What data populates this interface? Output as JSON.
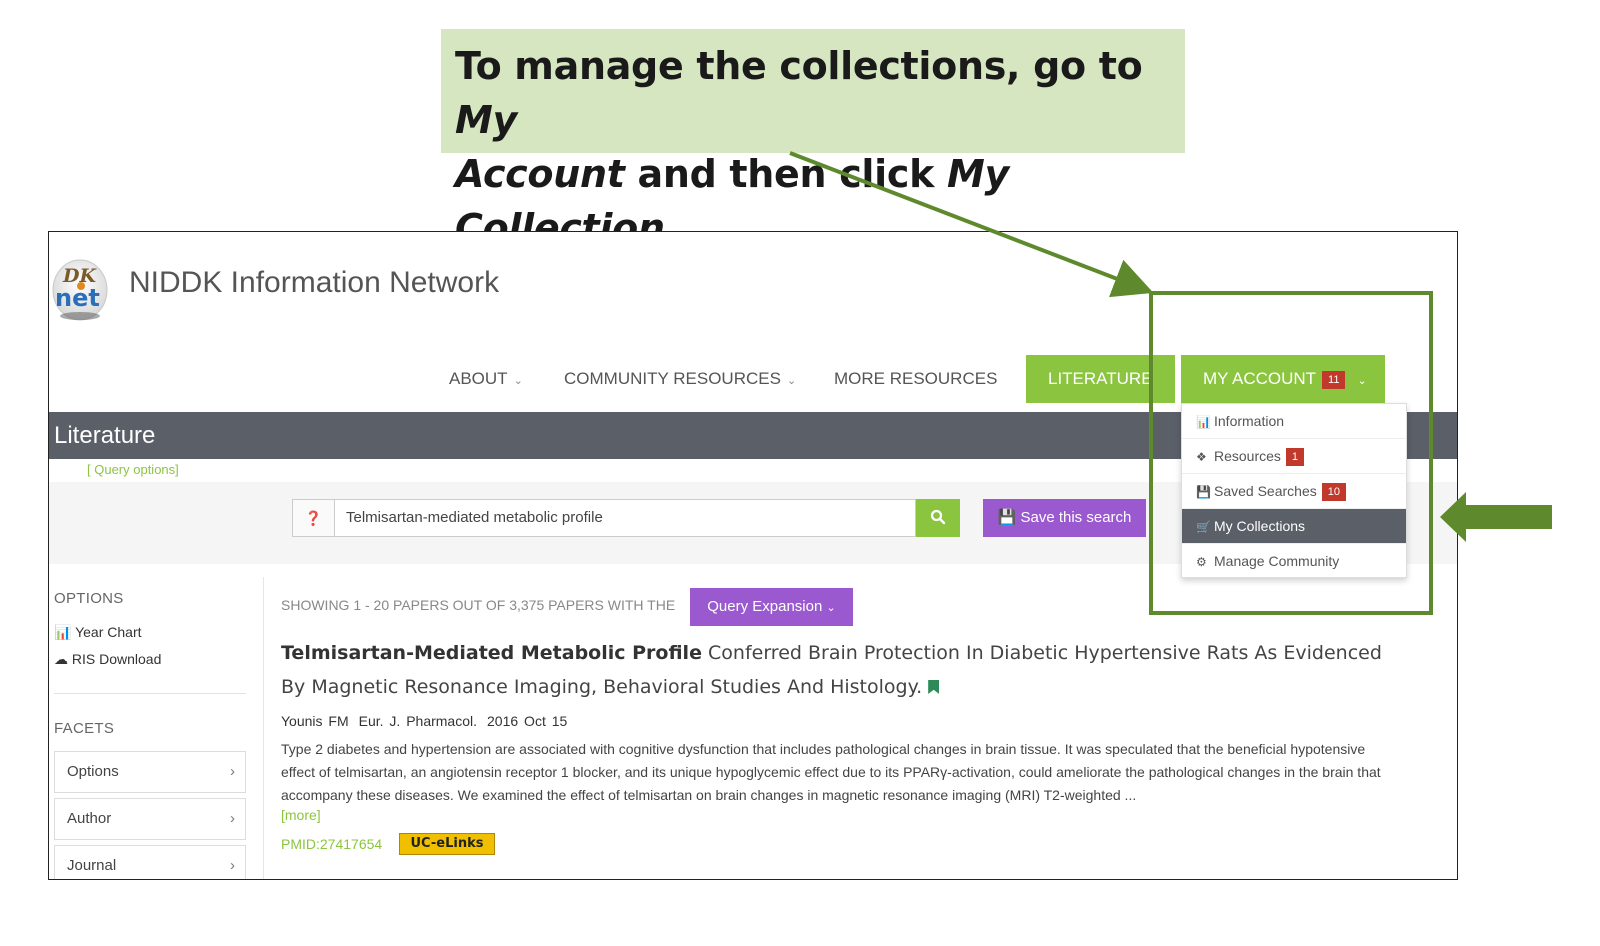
{
  "callout": {
    "line1_pre": "To manage the collections, go to ",
    "line1_em": "My",
    "line2_em": "Account",
    "line2_mid": " and then click ",
    "line2_em2": "My Collection"
  },
  "colors": {
    "accent_green": "#8bc53f",
    "purple": "#9b59d0",
    "dark_bar": "#5a5f68",
    "badge_red": "#c0392b",
    "annotation_green": "#5e8a2d",
    "callout_bg": "#d5e6c0"
  },
  "header": {
    "logo_text_top": "DK",
    "logo_text_bottom": "net",
    "site_title": "NIDDK Information Network"
  },
  "nav": {
    "about": "ABOUT",
    "community_resources": "COMMUNITY RESOURCES",
    "more_resources": "MORE RESOURCES",
    "literature": "LITERATURE",
    "my_account": "MY ACCOUNT",
    "my_account_badge": "11"
  },
  "account_menu": {
    "items": [
      {
        "label": "Information",
        "icon": "bar-chart-icon",
        "badge": ""
      },
      {
        "label": "Resources",
        "icon": "cubes-icon",
        "badge": "1"
      },
      {
        "label": "Saved Searches",
        "icon": "floppy-disk-icon",
        "badge": "10"
      },
      {
        "label": "My Collections",
        "icon": "shopping-cart-icon",
        "badge": ""
      },
      {
        "label": "Manage Community",
        "icon": "gears-icon",
        "badge": ""
      }
    ]
  },
  "page": {
    "section_title": "Literature",
    "query_options": "[ Query options]"
  },
  "search": {
    "value": "Telmisartan-mediated metabolic profile",
    "save_label": "Save this search"
  },
  "sidebar": {
    "options_heading": "OPTIONS",
    "year_chart": "Year Chart",
    "ris_download": "RIS Download",
    "facets_heading": "FACETS",
    "facets": [
      "Options",
      "Author",
      "Journal"
    ]
  },
  "results": {
    "showing": "SHOWING 1 - 20 PAPERS OUT OF 3,375 PAPERS WITH THE",
    "query_expansion": "Query Expansion",
    "paper": {
      "title_bold": "Telmisartan-Mediated Metabolic Profile",
      "title_rest": " Conferred Brain Protection In Diabetic Hypertensive Rats As Evidenced By Magnetic Resonance Imaging, Behavioral Studies And Histology.",
      "author": "Younis FM",
      "journal": "Eur. J. Pharmacol.",
      "date": "2016 Oct 15",
      "abstract": "Type 2 diabetes and hypertension are associated with cognitive dysfunction that includes pathological changes in brain tissue. It was speculated that the beneficial hypotensive effect of telmisartan, an angiotensin receptor 1 blocker, and its unique hypoglycemic effect due to its PPARγ-activation, could ameliorate the  pathological changes in the brain that accompany these diseases. We examined the effect of telmisartan on brain changes in magnetic resonance imaging (MRI) T2-weighted ...",
      "more": "[more]",
      "pmid": "PMID:27417654",
      "uc_elinks": "UC-eLinks"
    }
  }
}
